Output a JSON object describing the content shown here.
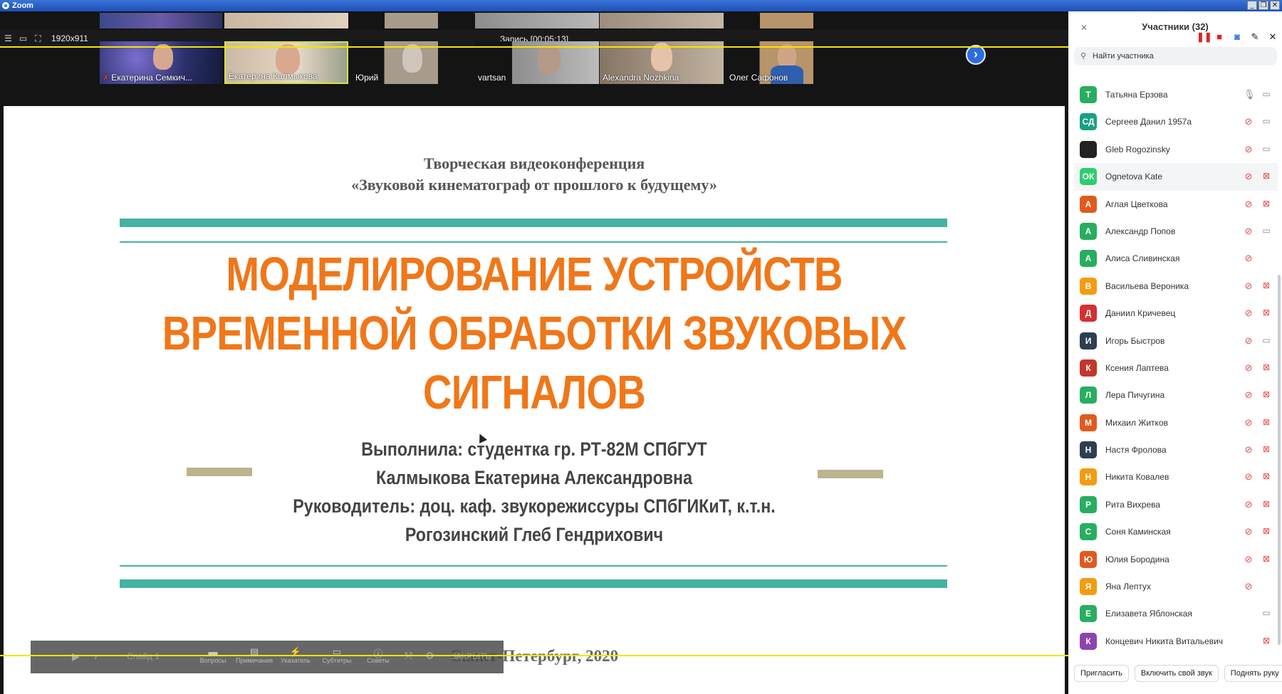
{
  "window": {
    "title": "Zoom",
    "buttons": [
      "_",
      "❐",
      "✕"
    ]
  },
  "toolbar": {
    "resolution": "1920x911",
    "recording_status": "Запись [00:05:13]"
  },
  "thumbnails": [
    {
      "name": "Екатерина Семкич...",
      "muted": true
    },
    {
      "name": "Екатерина Калмыкова",
      "muted": false
    },
    {
      "name": "Юрий",
      "muted": false
    },
    {
      "name": "vartsan",
      "muted": false
    },
    {
      "name": "Alexandra Nozhkina",
      "muted": false
    },
    {
      "name": "Олег Сафонов",
      "muted": false
    }
  ],
  "slide": {
    "conference_line1": "Творческая видеоконференция",
    "conference_line2": "«Звуковой кинематограф от прошлого к будущему»",
    "title_line1": "МОДЕЛИРОВАНИЕ УСТРОЙСТВ",
    "title_line2": "ВРЕМЕННОЙ ОБРАБОТКИ ЗВУКОВЫХ",
    "title_line3": "СИГНАЛОВ",
    "author_line1": "Выполнила: студентка гр. РТ-82М СПбГУТ",
    "author_line2": "Калмыкова Екатерина Александровна",
    "author_line3": "Руководитель: доц. каф. звукорежиссуры СПбГИКиТ, к.т.н.",
    "author_line4": "Рогозинский Глеб Гендрихович",
    "city_year": "Санкт-Петербург, 2020",
    "colors": {
      "accent_orange": "#f07719",
      "teal": "#45b2a2",
      "tan": "#bdb38c"
    }
  },
  "ppt_toolbar": {
    "slide_label": "Слайд 1",
    "tools": [
      "Вопросы",
      "Примечания",
      "Указатель",
      "Субтитры",
      "Советы"
    ],
    "close_label": "ЗАКРЫТЬ"
  },
  "panel": {
    "title": "Участники (32)",
    "search_placeholder": "Найти участника",
    "participants": [
      {
        "initials": "Т",
        "name": "Татьяна Ерзова",
        "color": "#27ae60",
        "mic": "on",
        "cam": "on"
      },
      {
        "initials": "СД",
        "name": "Сергеев Данил 1957а",
        "color": "#16a085",
        "mic": "off",
        "cam": "on"
      },
      {
        "initials": "",
        "name": "Gleb Rogozinsky",
        "color": "#222222",
        "mic": "off",
        "cam": "on"
      },
      {
        "initials": "ОК",
        "name": "Ognetova Kate",
        "color": "#2ecc71",
        "mic": "off",
        "cam": "off"
      },
      {
        "initials": "А",
        "name": "Аглая Цветкова",
        "color": "#e05a1e",
        "mic": "off",
        "cam": "off"
      },
      {
        "initials": "А",
        "name": "Александр Попов",
        "color": "#27ae60",
        "mic": "off",
        "cam": "on"
      },
      {
        "initials": "А",
        "name": "Алиса Сливинская",
        "color": "#27ae60",
        "mic": "off",
        "cam": "none"
      },
      {
        "initials": "В",
        "name": "Васильева Вероника",
        "color": "#f39c12",
        "mic": "off",
        "cam": "off"
      },
      {
        "initials": "Д",
        "name": "Даниил Кричевец",
        "color": "#d63031",
        "mic": "off",
        "cam": "off"
      },
      {
        "initials": "И",
        "name": "Игорь Быстров",
        "color": "#2c3e50",
        "mic": "off",
        "cam": "on"
      },
      {
        "initials": "К",
        "name": "Ксения Лаптева",
        "color": "#c0392b",
        "mic": "off",
        "cam": "off"
      },
      {
        "initials": "Л",
        "name": "Лера Пичугина",
        "color": "#27ae60",
        "mic": "off",
        "cam": "off"
      },
      {
        "initials": "М",
        "name": "Михаил Житков",
        "color": "#e05a1e",
        "mic": "off",
        "cam": "off"
      },
      {
        "initials": "Н",
        "name": "Настя Фролова",
        "color": "#2c3e50",
        "mic": "off",
        "cam": "off"
      },
      {
        "initials": "Н",
        "name": "Никита Ковалев",
        "color": "#f39c12",
        "mic": "off",
        "cam": "off"
      },
      {
        "initials": "Р",
        "name": "Рита Вихрева",
        "color": "#27ae60",
        "mic": "off",
        "cam": "off"
      },
      {
        "initials": "С",
        "name": "Соня Каминская",
        "color": "#27ae60",
        "mic": "off",
        "cam": "off"
      },
      {
        "initials": "Ю",
        "name": "Юлия Бородина",
        "color": "#e05a1e",
        "mic": "off",
        "cam": "off"
      },
      {
        "initials": "Я",
        "name": "Яна Лептух",
        "color": "#f39c12",
        "mic": "off",
        "cam": "none"
      },
      {
        "initials": "Е",
        "name": "Елизавета Яблонская",
        "color": "#27ae60",
        "mic": "none",
        "cam": "on"
      },
      {
        "initials": "К",
        "name": "Концевич Никита Витальевич",
        "color": "#8e44ad",
        "mic": "none",
        "cam": "off"
      }
    ],
    "footer_buttons": [
      "Пригласить",
      "Включить свой звук",
      "Поднять руку"
    ]
  }
}
